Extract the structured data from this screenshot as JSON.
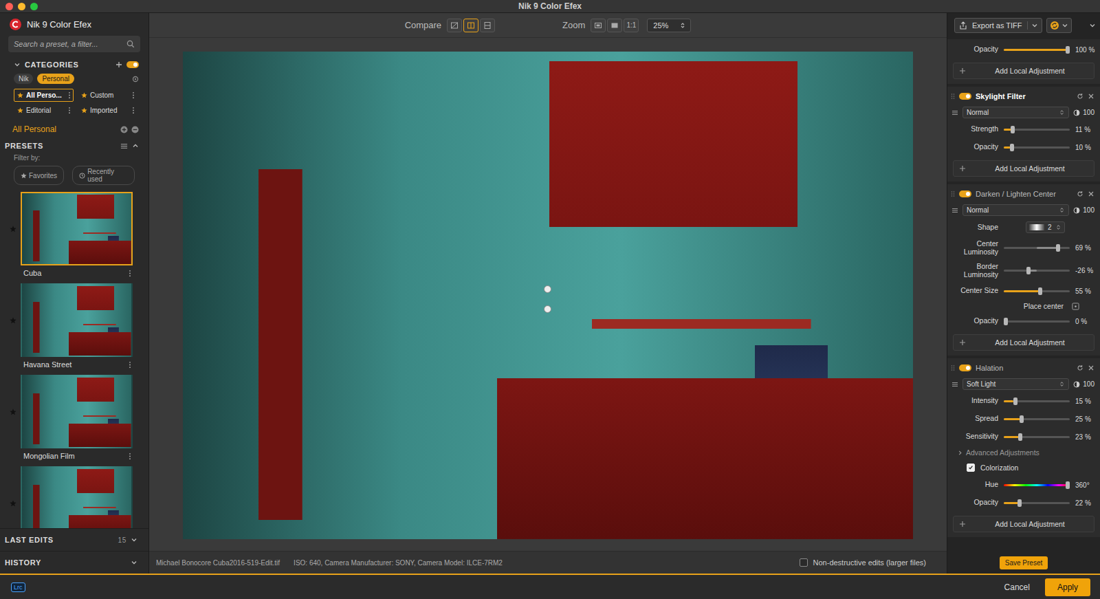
{
  "window": {
    "title": "Nik 9 Color Efex",
    "traffic_lights": [
      {
        "color": "#ff5f57"
      },
      {
        "color": "#febc2e"
      },
      {
        "color": "#28c840"
      }
    ]
  },
  "sidebar": {
    "app_name": "Nik 9 Color Efex",
    "search": {
      "placeholder": "Search a preset, a filter..."
    },
    "categories": {
      "title": "CATEGORIES",
      "expanded": true,
      "toggle_on": true,
      "sources": [
        {
          "label": "Nik",
          "selected": false
        },
        {
          "label": "Personal",
          "selected": true
        }
      ],
      "items": [
        {
          "label": "All Perso...",
          "selected": true
        },
        {
          "label": "Custom",
          "selected": false
        },
        {
          "label": "Editorial",
          "selected": false
        },
        {
          "label": "Imported",
          "selected": false
        }
      ]
    },
    "current_category": "All Personal",
    "presets": {
      "title": "PRESETS",
      "expanded": true,
      "filter_label": "Filter by:",
      "filters": [
        {
          "label": "Favorites",
          "selected": false
        },
        {
          "label": "Recently used",
          "selected": false
        }
      ],
      "items": [
        {
          "name": "Cuba",
          "selected": true
        },
        {
          "name": "Havana Street",
          "selected": false
        },
        {
          "name": "Mongolian Film",
          "selected": false
        },
        {
          "selected": false
        }
      ]
    },
    "last_edits": {
      "title": "LAST EDITS",
      "count": "15",
      "expanded": false
    },
    "history": {
      "title": "HISTORY",
      "expanded": false
    }
  },
  "toolbar": {
    "compare": {
      "label": "Compare",
      "modes": [
        {
          "selected": false
        },
        {
          "selected": true
        },
        {
          "selected": false
        }
      ]
    },
    "zoom": {
      "label": "Zoom",
      "buttons": [
        {
          "kind": "fit",
          "selected": false
        },
        {
          "kind": "fill",
          "selected": false
        },
        {
          "kind": "text",
          "label": "1:1",
          "selected": false
        }
      ],
      "value": "25%"
    }
  },
  "status_bar": {
    "file": "Michael Bonocore Cuba2016-519-Edit.tif",
    "info": "ISO: 640, Camera Manufacturer: SONY, Camera Model: ILCE-7RM2",
    "nondestructive": {
      "label": "Non-destructive edits (larger files)",
      "checked": false
    }
  },
  "panel": {
    "export": {
      "label": "Export as TIFF"
    },
    "sections": [
      {
        "rows": [
          {
            "kind": "slider",
            "label": "Opacity",
            "value": "100 %",
            "level": 1
          }
        ],
        "add": "Add Local Adjustment"
      },
      {
        "title": "Skylight Filter",
        "enabled": true,
        "selected": true,
        "blend": "Normal",
        "opacity": "100",
        "rows": [
          {
            "kind": "slider",
            "label": "Strength",
            "value": "11 %",
            "level": 0.11
          },
          {
            "kind": "slider",
            "label": "Opacity",
            "value": "10 %",
            "level": 0.1
          }
        ],
        "add": "Add Local Adjustment"
      },
      {
        "title": "Darken / Lighten Center",
        "enabled": true,
        "selected": false,
        "blend": "Normal",
        "opacity": "100",
        "rows": [
          {
            "kind": "stepper",
            "label": "Shape",
            "value": "2"
          },
          {
            "kind": "bipolar",
            "label": "Center Luminosity",
            "value": "69 %",
            "level": 0.845
          },
          {
            "kind": "bipolar",
            "label": "Border Luminosity",
            "value": "-26 %",
            "level": 0.37
          },
          {
            "kind": "slider",
            "label": "Center Size",
            "value": "55 %",
            "level": 0.55
          },
          {
            "kind": "button",
            "label": "Place center"
          },
          {
            "kind": "slider",
            "label": "Opacity",
            "value": "0 %",
            "level": 0
          }
        ],
        "add": "Add Local Adjustment"
      },
      {
        "title": "Halation",
        "enabled": true,
        "selected": false,
        "blend": "Soft Light",
        "opacity": "100",
        "rows": [
          {
            "kind": "slider",
            "label": "Intensity",
            "value": "15 %",
            "level": 0.15
          },
          {
            "kind": "slider",
            "label": "Spread",
            "value": "25 %",
            "level": 0.25
          },
          {
            "kind": "slider",
            "label": "Sensitivity",
            "value": "23 %",
            "level": 0.23
          },
          {
            "kind": "link",
            "label": "Advanced Adjustments",
            "expanded": false
          },
          {
            "kind": "checkbox",
            "label": "Colorization",
            "checked": true
          },
          {
            "kind": "hue",
            "label": "Hue",
            "value": "360°",
            "level": 1
          },
          {
            "kind": "slider",
            "label": "Opacity",
            "value": "22 %",
            "level": 0.22
          }
        ],
        "add": "Add Local Adjustment"
      }
    ],
    "save": "Save Preset"
  },
  "footer": {
    "lrc": "Lrc",
    "cancel": "Cancel",
    "apply": "Apply"
  }
}
